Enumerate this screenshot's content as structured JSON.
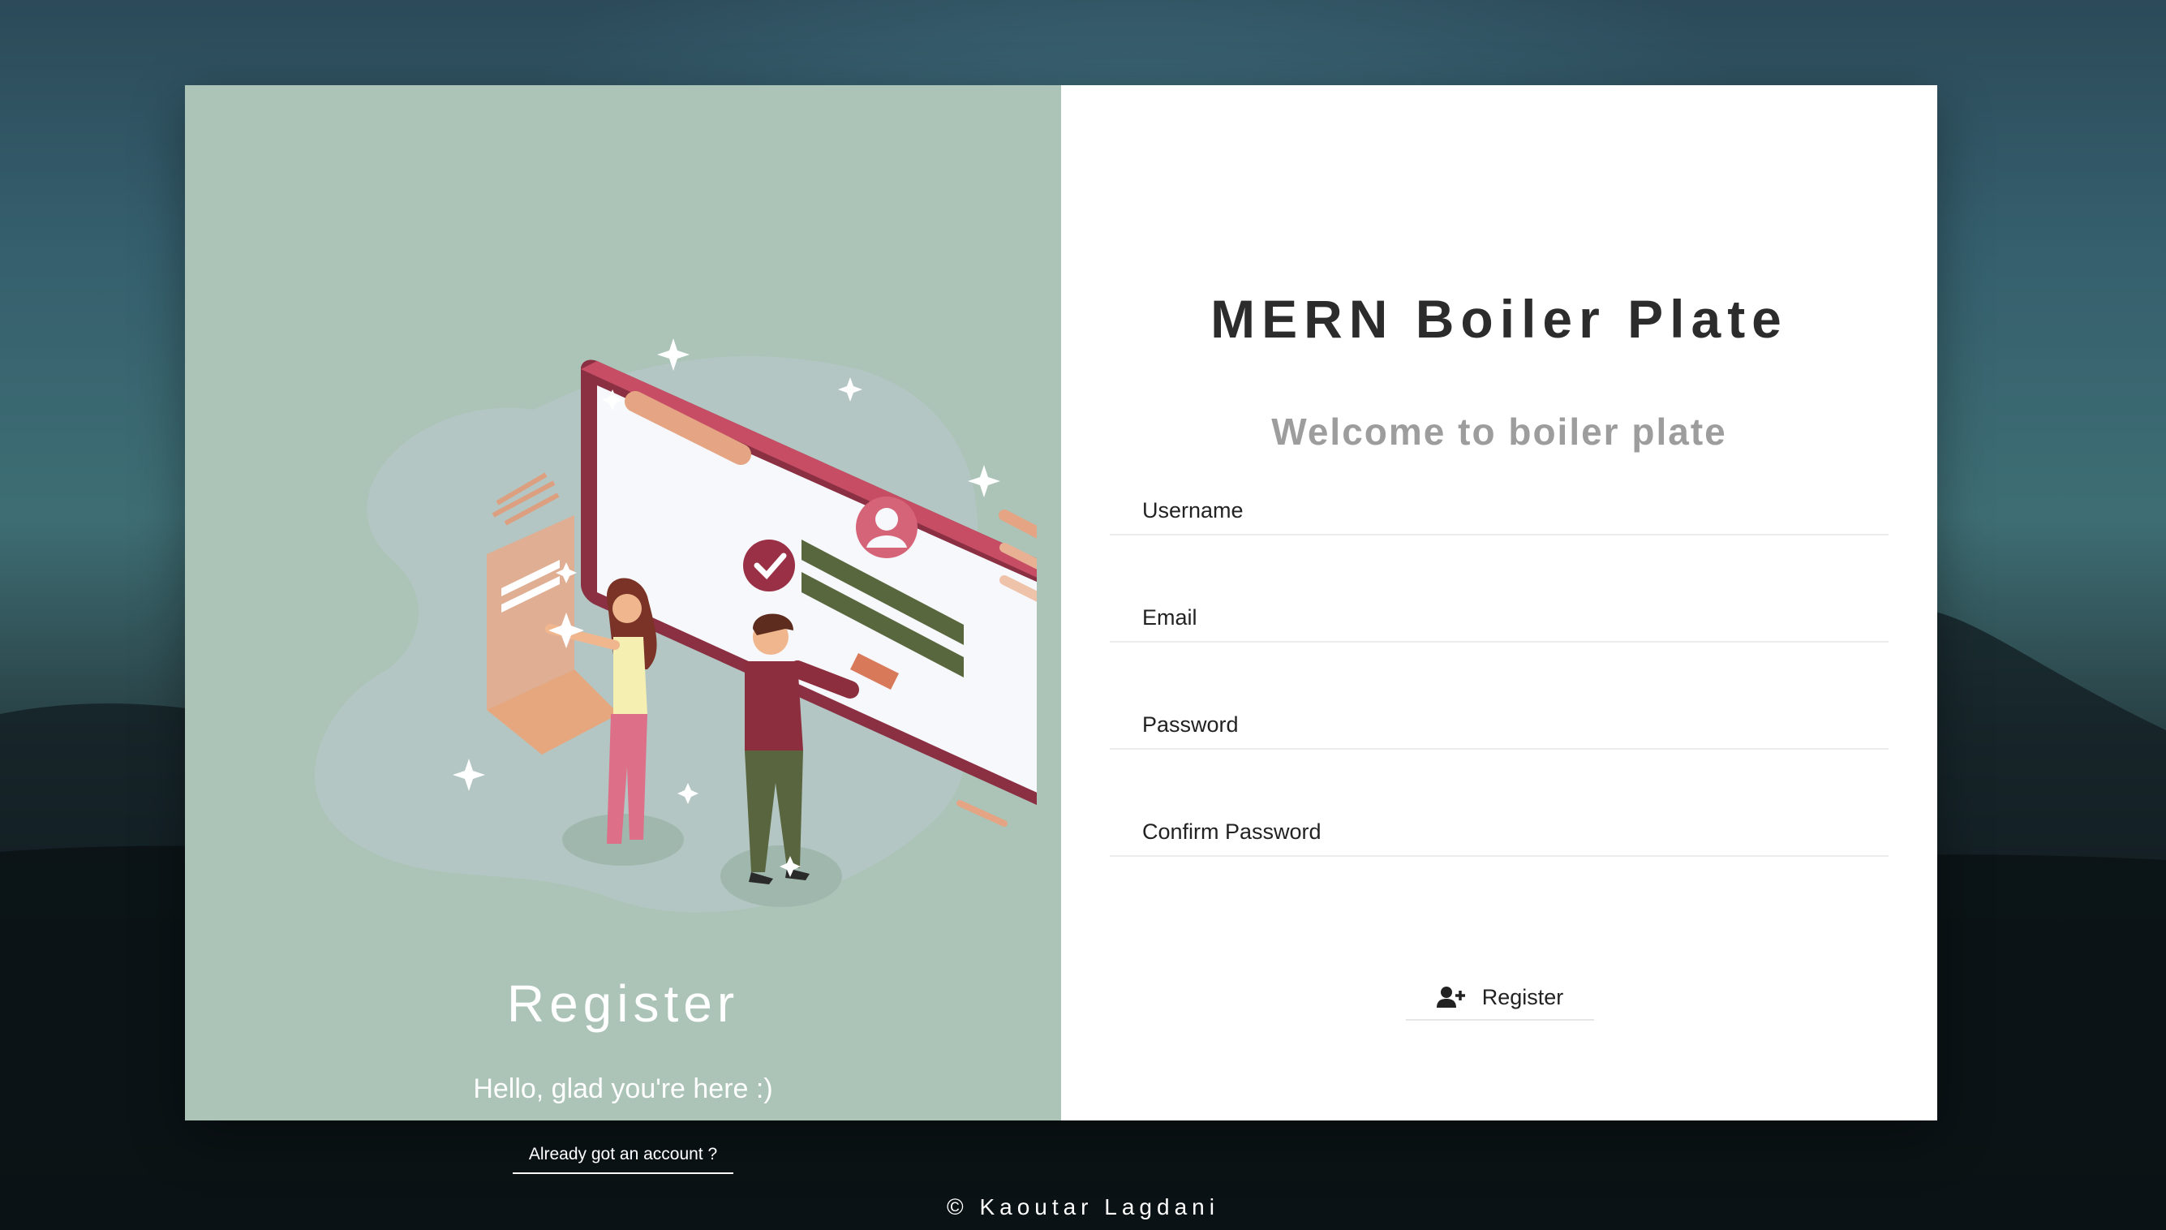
{
  "left_panel": {
    "title": "Register",
    "subtitle": "Hello, glad you're here :)",
    "login_link": "Already got an account ?",
    "bg_color": "#abc4b7"
  },
  "right_panel": {
    "app_title": "MERN Boiler Plate",
    "welcome": "Welcome to boiler plate",
    "fields": {
      "username": {
        "placeholder": "Username",
        "value": ""
      },
      "email": {
        "placeholder": "Email",
        "value": ""
      },
      "password": {
        "placeholder": "Password",
        "value": ""
      },
      "confirm_password": {
        "placeholder": "Confirm Password",
        "value": ""
      }
    },
    "register_button": {
      "label": "Register",
      "icon": "user-plus-icon"
    }
  },
  "footer": {
    "text": "© Kaoutar Lagdani"
  }
}
